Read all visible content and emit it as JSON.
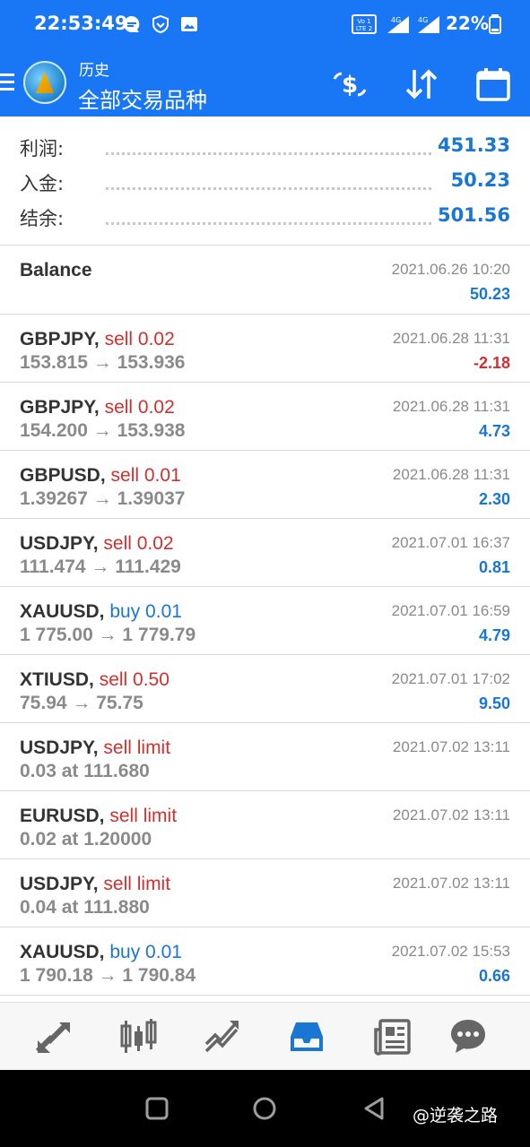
{
  "status_bar": {
    "time": "22:53:49",
    "battery": "22%",
    "icons": [
      "message-icon",
      "shield-icon",
      "image-icon",
      "volte-icon",
      "signal-4g-icon",
      "signal-4g-icon",
      "battery-icon"
    ]
  },
  "app_bar": {
    "subtitle": "历史",
    "title": "全部交易品种",
    "icons": [
      "menu-icon",
      "app-logo",
      "currency-swap-icon",
      "sort-icon",
      "calendar-icon"
    ]
  },
  "summary": {
    "profit_label": "利润:",
    "profit_value": "451.33",
    "deposit_label": "入金:",
    "deposit_value": "50.23",
    "balance_label": "结余:",
    "balance_value": "501.56"
  },
  "balance_entry": {
    "label": "Balance",
    "datetime": "2021.06.26 10:20",
    "amount": "50.23"
  },
  "trades": [
    {
      "symbol": "GBPJPY,",
      "action": "sell 0.02",
      "side": "sell",
      "detail": "153.815 → 153.936",
      "datetime": "2021.06.28 11:31",
      "profit": "-2.18",
      "negative": true
    },
    {
      "symbol": "GBPJPY,",
      "action": "sell 0.02",
      "side": "sell",
      "detail": "154.200 → 153.938",
      "datetime": "2021.06.28 11:31",
      "profit": "4.73"
    },
    {
      "symbol": "GBPUSD,",
      "action": "sell 0.01",
      "side": "sell",
      "detail": "1.39267 → 1.39037",
      "datetime": "2021.06.28 11:31",
      "profit": "2.30"
    },
    {
      "symbol": "USDJPY,",
      "action": "sell 0.02",
      "side": "sell",
      "detail": "111.474 → 111.429",
      "datetime": "2021.07.01 16:37",
      "profit": "0.81"
    },
    {
      "symbol": "XAUUSD,",
      "action": "buy 0.01",
      "side": "buy",
      "detail": "1 775.00 → 1 779.79",
      "datetime": "2021.07.01 16:59",
      "profit": "4.79"
    },
    {
      "symbol": "XTIUSD,",
      "action": "sell 0.50",
      "side": "sell",
      "detail": "75.94 → 75.75",
      "datetime": "2021.07.01 17:02",
      "profit": "9.50"
    },
    {
      "symbol": "USDJPY,",
      "action": "sell limit",
      "side": "sell",
      "detail": "0.03 at 111.680",
      "datetime": "2021.07.02 13:11",
      "profit": ""
    },
    {
      "symbol": "EURUSD,",
      "action": "sell limit",
      "side": "sell",
      "detail": "0.02 at 1.20000",
      "datetime": "2021.07.02 13:11",
      "profit": ""
    },
    {
      "symbol": "USDJPY,",
      "action": "sell limit",
      "side": "sell",
      "detail": "0.04 at 111.880",
      "datetime": "2021.07.02 13:11",
      "profit": ""
    },
    {
      "symbol": "XAUUSD,",
      "action": "buy 0.01",
      "side": "buy",
      "detail": "1 790.18 → 1 790.84",
      "datetime": "2021.07.02 15:53",
      "profit": "0.66"
    }
  ],
  "tab_bar": {
    "tabs": [
      "quotes-tab-icon",
      "chart-tab-icon",
      "trade-tab-icon",
      "history-tab-icon",
      "news-tab-icon",
      "chat-tab-icon"
    ],
    "active_index": 3
  },
  "system_nav": {
    "icons": [
      "recents-icon",
      "home-icon",
      "back-icon"
    ],
    "watermark": "@逆袭之路"
  },
  "colors": {
    "brand_blue": "#1976f5",
    "profit_blue": "#1976d2",
    "sell_red": "#d32f2f"
  }
}
